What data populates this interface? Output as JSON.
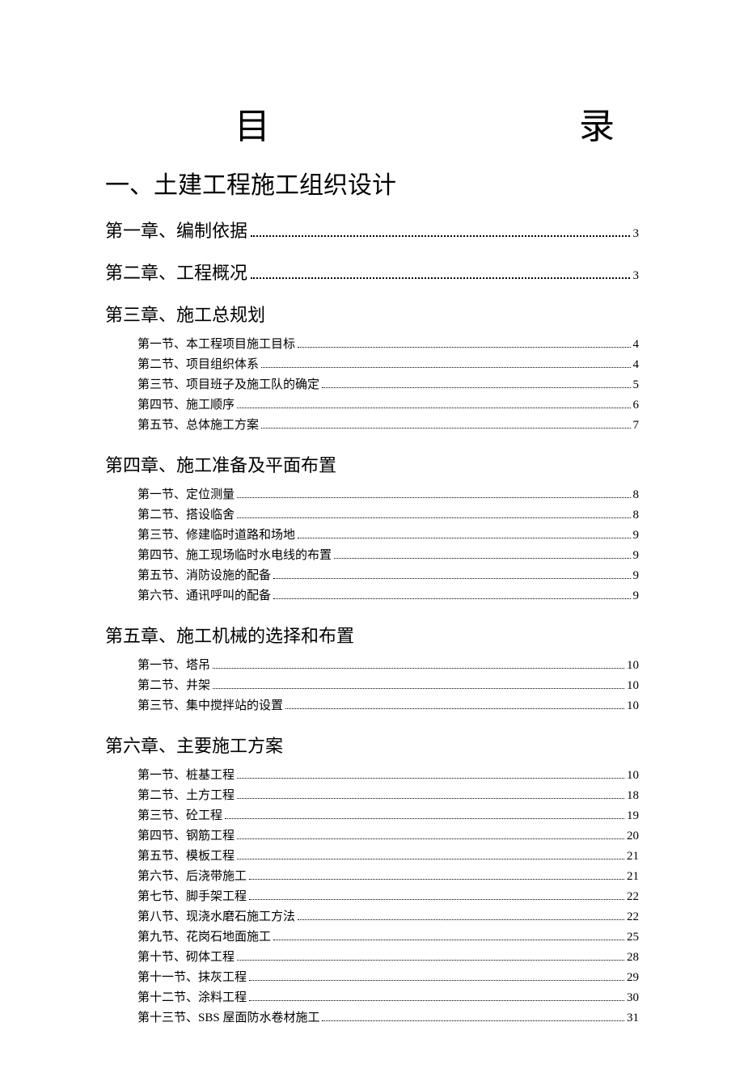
{
  "title_left": "目",
  "title_right": "录",
  "part_title": "一、土建工程施工组织设计",
  "chapters": [
    {
      "title": "第一章、编制依据",
      "page": "3",
      "sections": []
    },
    {
      "title": "第二章、工程概况",
      "page": "3",
      "sections": []
    },
    {
      "title": "第三章、施工总规划",
      "page": "",
      "sections": [
        {
          "label": "第一节、本工程项目施工目标",
          "page": "4"
        },
        {
          "label": "第二节、项目组织体系",
          "page": "4"
        },
        {
          "label": "第三节、项目班子及施工队的确定",
          "page": "5"
        },
        {
          "label": "第四节、施工顺序",
          "page": "6"
        },
        {
          "label": "第五节、总体施工方案",
          "page": "7"
        }
      ]
    },
    {
      "title": "第四章、施工准备及平面布置",
      "page": "",
      "sections": [
        {
          "label": "第一节、定位测量",
          "page": "8"
        },
        {
          "label": "第二节、搭设临舍",
          "page": "8"
        },
        {
          "label": "第三节、修建临时道路和场地",
          "page": "9"
        },
        {
          "label": "第四节、施工现场临时水电线的布置",
          "page": "9"
        },
        {
          "label": "第五节、消防设施的配备",
          "page": "9"
        },
        {
          "label": "第六节、通讯呼叫的配备",
          "page": "9"
        }
      ]
    },
    {
      "title": "第五章、施工机械的选择和布置",
      "page": "",
      "sections": [
        {
          "label": "第一节、塔吊",
          "page": "10"
        },
        {
          "label": "第二节、井架",
          "page": "10"
        },
        {
          "label": "第三节、集中搅拌站的设置",
          "page": "10"
        }
      ]
    },
    {
      "title": "第六章、主要施工方案",
      "page": "",
      "sections": [
        {
          "label": "第一节、桩基工程",
          "page": "10"
        },
        {
          "label": "第二节、土方工程",
          "page": "18"
        },
        {
          "label": "第三节、砼工程",
          "page": "19"
        },
        {
          "label": "第四节、钢筋工程",
          "page": "20"
        },
        {
          "label": "第五节、模板工程",
          "page": "21"
        },
        {
          "label": "第六节、后浇带施工",
          "page": "21"
        },
        {
          "label": "第七节、脚手架工程",
          "page": "22"
        },
        {
          "label": "第八节、现浇水磨石施工方法",
          "page": "22"
        },
        {
          "label": "第九节、花岗石地面施工",
          "page": "25"
        },
        {
          "label": "第十节、砌体工程",
          "page": "28"
        },
        {
          "label": "第十一节、抹灰工程",
          "page": "29"
        },
        {
          "label": "第十二节、涂料工程",
          "page": "30"
        },
        {
          "label": "第十三节、SBS 屋面防水卷材施工",
          "page": "31"
        }
      ]
    }
  ]
}
